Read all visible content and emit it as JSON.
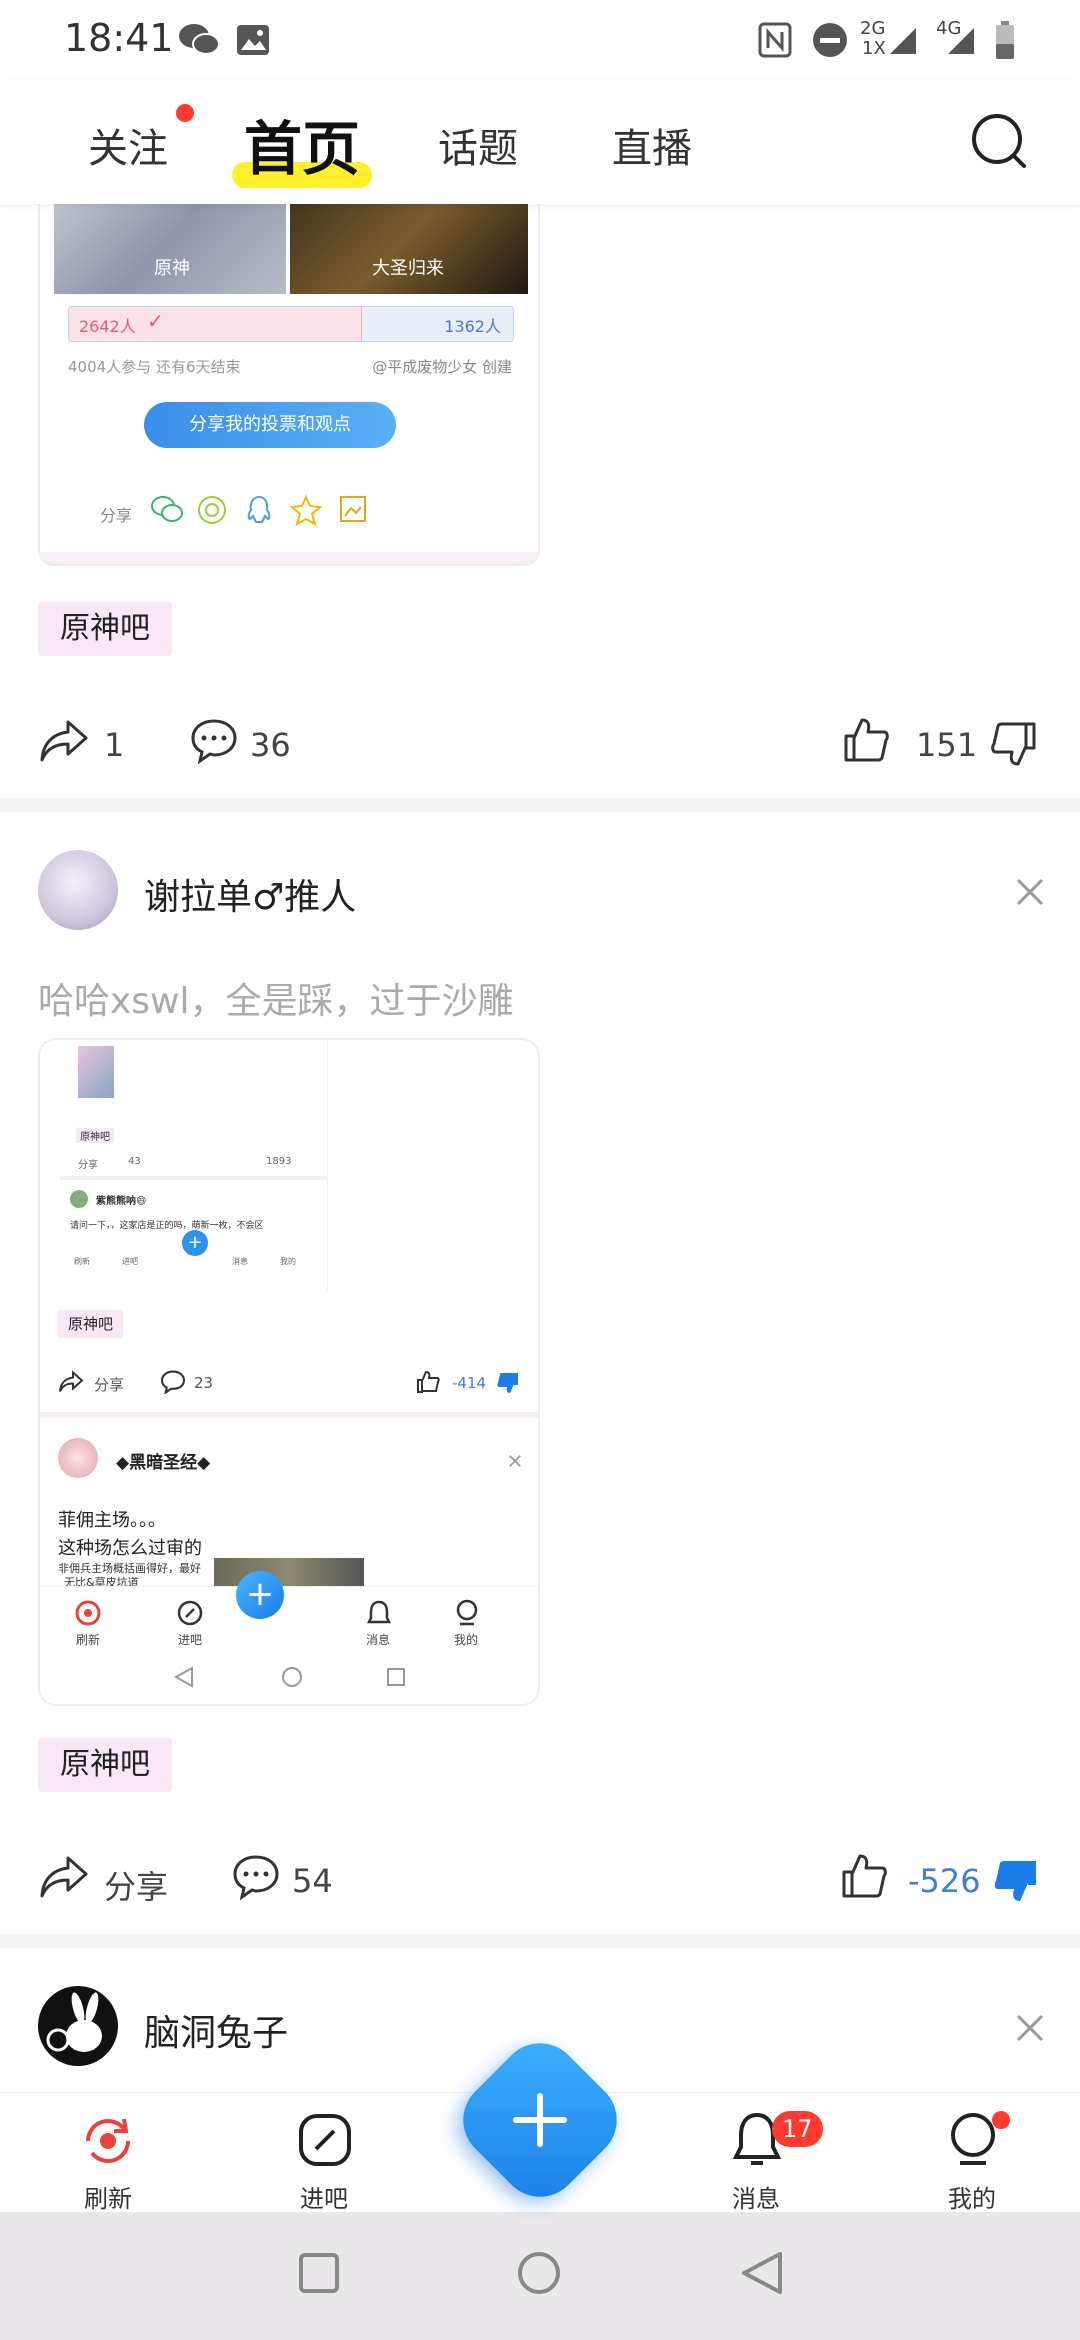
{
  "status": {
    "time": "18:41",
    "network1": "2G",
    "network1b": "1X",
    "network2": "4G"
  },
  "header": {
    "tabs": [
      {
        "label": "关注"
      },
      {
        "label": "首页"
      },
      {
        "label": "话题"
      },
      {
        "label": "直播"
      }
    ]
  },
  "post1": {
    "poll_left_label": "原神",
    "poll_right_label": "大圣归来",
    "poll_left_count": "2642人",
    "poll_right_count": "1362人",
    "poll_left_fraction": 0.66,
    "participants": "4004人参与  还有6天结束",
    "creator": "@平成废物少女 创建",
    "share_button": "分享我的投票和观点",
    "share_label": "分享",
    "tag": "原神吧",
    "share_count": "1",
    "comment_count": "36",
    "like_count": "151"
  },
  "post2": {
    "author": "谢拉单♂推人",
    "text": "哈哈xswl，全是踩，过于沙雕",
    "tag": "原神吧",
    "share_label": "分享",
    "comment_count": "54",
    "like_count": "-526",
    "inner": {
      "tag": "原神吧",
      "share_label": "分享",
      "comment_count": "23",
      "like_count": "-414",
      "author": "◆黑暗圣经◆",
      "line1": "菲佣主场。。。",
      "line2": "这种场怎么过审的",
      "nav_refresh": "刷新",
      "nav_bar": "进吧",
      "nav_msg": "消息",
      "nav_mine": "我的",
      "tiny_name": "紫熊熊呐😄",
      "tiny_text": "请问一下，，这家店是正的吗，萌新一枚，不会区",
      "tiny_tag": "原神吧",
      "tiny_comments": "43",
      "tiny_likes": "1893",
      "tiny_share": "分享",
      "tiny_nav": [
        "刷新",
        "进吧",
        "消息",
        "我的"
      ],
      "img_caption1": "非佣兵主场概括画得好，最好",
      "img_caption2": "无比&草皮坑道"
    }
  },
  "post3": {
    "author": "脑洞兔子"
  },
  "bottomnav": {
    "refresh": "刷新",
    "bar": "进吧",
    "messages": "消息",
    "mine": "我的",
    "messages_badge": "17"
  },
  "colors": {
    "accent": "#1a8cff",
    "red": "#ff3b30",
    "tag_bg": "#f8e8f5",
    "highlight": "#ffef2a"
  }
}
